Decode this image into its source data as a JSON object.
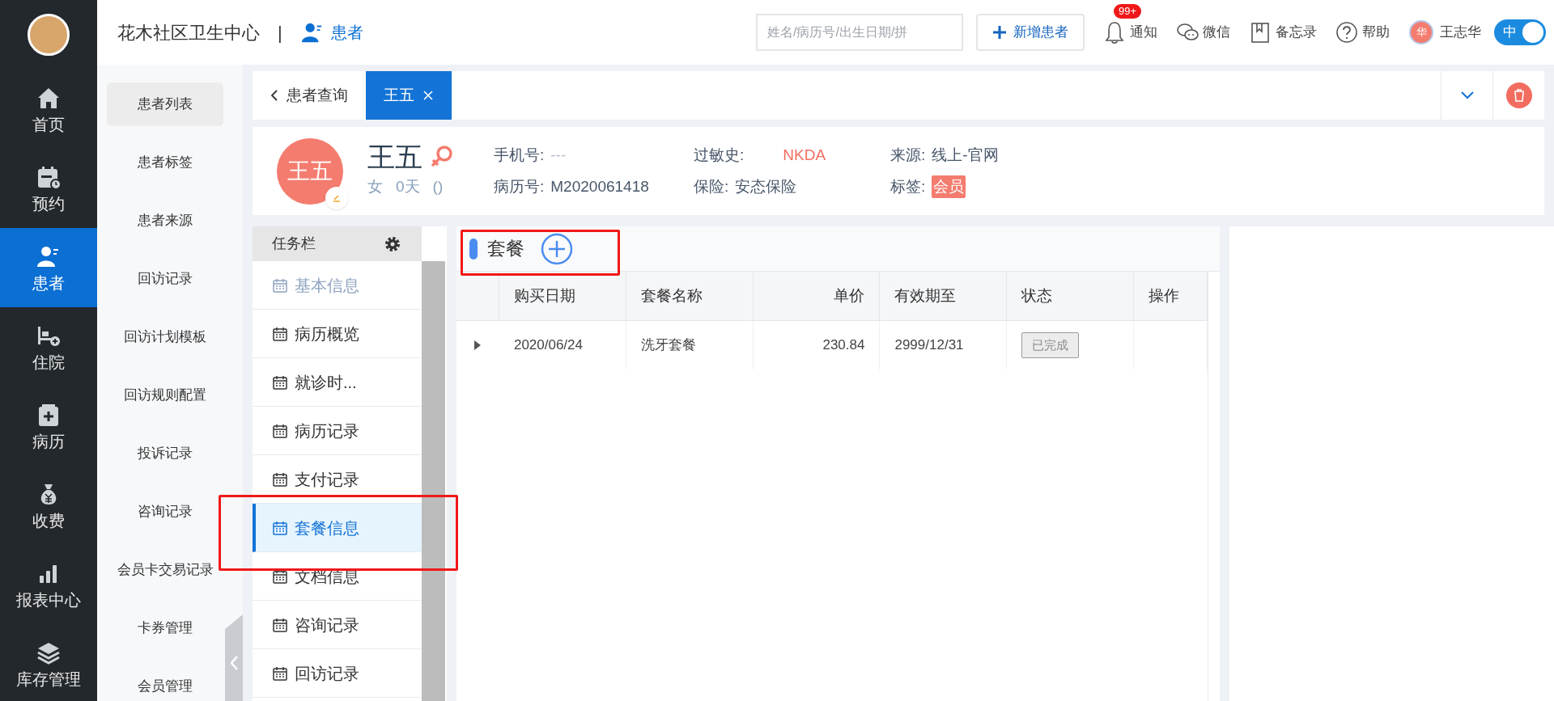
{
  "nav": [
    {
      "label": "首页",
      "kind": "home",
      "selected": false
    },
    {
      "label": "预约",
      "kind": "calendar",
      "selected": false
    },
    {
      "label": "患者",
      "kind": "patient",
      "selected": true
    },
    {
      "label": "住院",
      "kind": "bed",
      "selected": false
    },
    {
      "label": "病历",
      "kind": "record",
      "selected": false
    },
    {
      "label": "收费",
      "kind": "money",
      "selected": false
    },
    {
      "label": "报表中心",
      "kind": "chart",
      "selected": false
    },
    {
      "label": "库存管理",
      "kind": "layers",
      "selected": false
    }
  ],
  "submenu": [
    {
      "label": "患者列表",
      "selected": true
    },
    {
      "label": "患者标签",
      "selected": false
    },
    {
      "label": "患者来源",
      "selected": false
    },
    {
      "label": "回访记录",
      "selected": false
    },
    {
      "label": "回访计划模板",
      "selected": false
    },
    {
      "label": "回访规则配置",
      "selected": false
    },
    {
      "label": "投诉记录",
      "selected": false
    },
    {
      "label": "咨询记录",
      "selected": false
    },
    {
      "label": "会员卡交易记录",
      "selected": false
    },
    {
      "label": "卡券管理",
      "selected": false
    },
    {
      "label": "会员管理",
      "selected": false
    }
  ],
  "header": {
    "clinic": "花木社区卫生中心",
    "separator": "|",
    "section": "患者",
    "search_placeholder": "姓名/病历号/出生日期/拼",
    "new_button": "新增患者",
    "notify": "通知",
    "badge": "99+",
    "wechat": "微信",
    "memo": "备忘录",
    "help": "帮助",
    "user_initial": "华",
    "user": "王志华",
    "toggle": {
      "label": "中",
      "on": true
    }
  },
  "tabs": [
    {
      "label": "患者查询",
      "selected": false,
      "kind": "back"
    },
    {
      "label": "王五",
      "selected": true,
      "kind": "closable"
    }
  ],
  "patient": {
    "avatar": "王五",
    "name": "王五",
    "gender": "女",
    "age": "0天",
    "extra": "()",
    "phone_label": "手机号:",
    "phone": "---",
    "record_label": "病历号:",
    "record": "M2020061418",
    "allergy_label": "过敏史:",
    "allergy": "NKDA",
    "insurance_label": "保险:",
    "insurance": "安态保险",
    "source_label": "来源:",
    "source": "线上-官网",
    "tag_label": "标签:",
    "tag": "会员"
  },
  "taskbar": {
    "title": "任务栏",
    "items": [
      {
        "label": "基本信息",
        "selected": false,
        "disabled": true
      },
      {
        "label": "病历概览",
        "selected": false,
        "disabled": false
      },
      {
        "label": "就诊时...",
        "selected": false,
        "disabled": false
      },
      {
        "label": "病历记录",
        "selected": false,
        "disabled": false
      },
      {
        "label": "支付记录",
        "selected": false,
        "disabled": false
      },
      {
        "label": "套餐信息",
        "selected": true,
        "disabled": false
      },
      {
        "label": "文档信息",
        "selected": false,
        "disabled": false
      },
      {
        "label": "咨询记录",
        "selected": false,
        "disabled": false
      },
      {
        "label": "回访记录",
        "selected": false,
        "disabled": false
      }
    ]
  },
  "panel": {
    "title": "套餐",
    "table": {
      "columns": [
        "购买日期",
        "套餐名称",
        "单价",
        "有效期至",
        "状态",
        "操作"
      ],
      "rows": [
        {
          "expanded": false,
          "cells": [
            "2020/06/24",
            "洗牙套餐",
            "230.84",
            "2999/12/31"
          ],
          "status": "已完成"
        }
      ]
    }
  }
}
